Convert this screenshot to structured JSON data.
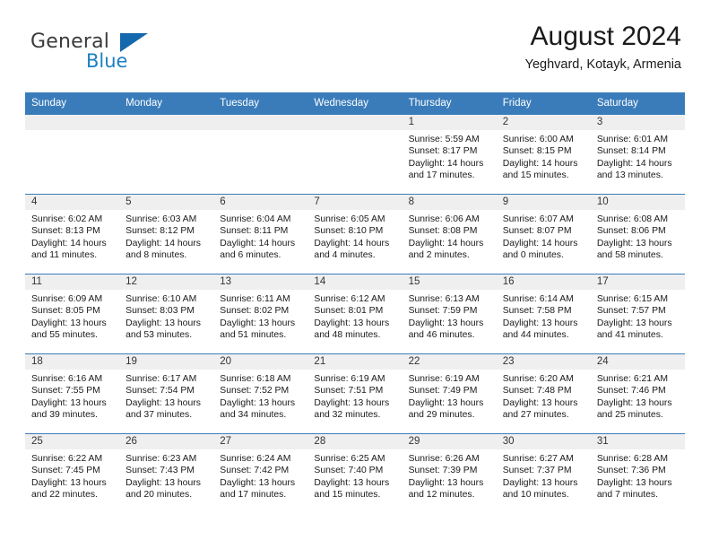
{
  "brand": {
    "word_one": "General",
    "word_two": "Blue",
    "triangle_icon": "triangle-icon",
    "colors": {
      "blue": "#1c7fc4",
      "dark": "#3b3b3b",
      "triangle": "#1668ad"
    }
  },
  "header": {
    "title": "August 2024",
    "subtitle": "Yeghvard, Kotayk, Armenia"
  },
  "calendar": {
    "accent_color": "#3a7cba",
    "weekday_headers": [
      "Sunday",
      "Monday",
      "Tuesday",
      "Wednesday",
      "Thursday",
      "Friday",
      "Saturday"
    ],
    "labels": {
      "sunrise": "Sunrise:",
      "sunset": "Sunset:",
      "daylight": "Daylight:"
    },
    "weeks": [
      [
        {
          "day": ""
        },
        {
          "day": ""
        },
        {
          "day": ""
        },
        {
          "day": ""
        },
        {
          "day": "1",
          "sunrise": "Sunrise: 5:59 AM",
          "sunset": "Sunset: 8:17 PM",
          "daylight_1": "Daylight: 14 hours",
          "daylight_2": "and 17 minutes."
        },
        {
          "day": "2",
          "sunrise": "Sunrise: 6:00 AM",
          "sunset": "Sunset: 8:15 PM",
          "daylight_1": "Daylight: 14 hours",
          "daylight_2": "and 15 minutes."
        },
        {
          "day": "3",
          "sunrise": "Sunrise: 6:01 AM",
          "sunset": "Sunset: 8:14 PM",
          "daylight_1": "Daylight: 14 hours",
          "daylight_2": "and 13 minutes."
        }
      ],
      [
        {
          "day": "4",
          "sunrise": "Sunrise: 6:02 AM",
          "sunset": "Sunset: 8:13 PM",
          "daylight_1": "Daylight: 14 hours",
          "daylight_2": "and 11 minutes."
        },
        {
          "day": "5",
          "sunrise": "Sunrise: 6:03 AM",
          "sunset": "Sunset: 8:12 PM",
          "daylight_1": "Daylight: 14 hours",
          "daylight_2": "and 8 minutes."
        },
        {
          "day": "6",
          "sunrise": "Sunrise: 6:04 AM",
          "sunset": "Sunset: 8:11 PM",
          "daylight_1": "Daylight: 14 hours",
          "daylight_2": "and 6 minutes."
        },
        {
          "day": "7",
          "sunrise": "Sunrise: 6:05 AM",
          "sunset": "Sunset: 8:10 PM",
          "daylight_1": "Daylight: 14 hours",
          "daylight_2": "and 4 minutes."
        },
        {
          "day": "8",
          "sunrise": "Sunrise: 6:06 AM",
          "sunset": "Sunset: 8:08 PM",
          "daylight_1": "Daylight: 14 hours",
          "daylight_2": "and 2 minutes."
        },
        {
          "day": "9",
          "sunrise": "Sunrise: 6:07 AM",
          "sunset": "Sunset: 8:07 PM",
          "daylight_1": "Daylight: 14 hours",
          "daylight_2": "and 0 minutes."
        },
        {
          "day": "10",
          "sunrise": "Sunrise: 6:08 AM",
          "sunset": "Sunset: 8:06 PM",
          "daylight_1": "Daylight: 13 hours",
          "daylight_2": "and 58 minutes."
        }
      ],
      [
        {
          "day": "11",
          "sunrise": "Sunrise: 6:09 AM",
          "sunset": "Sunset: 8:05 PM",
          "daylight_1": "Daylight: 13 hours",
          "daylight_2": "and 55 minutes."
        },
        {
          "day": "12",
          "sunrise": "Sunrise: 6:10 AM",
          "sunset": "Sunset: 8:03 PM",
          "daylight_1": "Daylight: 13 hours",
          "daylight_2": "and 53 minutes."
        },
        {
          "day": "13",
          "sunrise": "Sunrise: 6:11 AM",
          "sunset": "Sunset: 8:02 PM",
          "daylight_1": "Daylight: 13 hours",
          "daylight_2": "and 51 minutes."
        },
        {
          "day": "14",
          "sunrise": "Sunrise: 6:12 AM",
          "sunset": "Sunset: 8:01 PM",
          "daylight_1": "Daylight: 13 hours",
          "daylight_2": "and 48 minutes."
        },
        {
          "day": "15",
          "sunrise": "Sunrise: 6:13 AM",
          "sunset": "Sunset: 7:59 PM",
          "daylight_1": "Daylight: 13 hours",
          "daylight_2": "and 46 minutes."
        },
        {
          "day": "16",
          "sunrise": "Sunrise: 6:14 AM",
          "sunset": "Sunset: 7:58 PM",
          "daylight_1": "Daylight: 13 hours",
          "daylight_2": "and 44 minutes."
        },
        {
          "day": "17",
          "sunrise": "Sunrise: 6:15 AM",
          "sunset": "Sunset: 7:57 PM",
          "daylight_1": "Daylight: 13 hours",
          "daylight_2": "and 41 minutes."
        }
      ],
      [
        {
          "day": "18",
          "sunrise": "Sunrise: 6:16 AM",
          "sunset": "Sunset: 7:55 PM",
          "daylight_1": "Daylight: 13 hours",
          "daylight_2": "and 39 minutes."
        },
        {
          "day": "19",
          "sunrise": "Sunrise: 6:17 AM",
          "sunset": "Sunset: 7:54 PM",
          "daylight_1": "Daylight: 13 hours",
          "daylight_2": "and 37 minutes."
        },
        {
          "day": "20",
          "sunrise": "Sunrise: 6:18 AM",
          "sunset": "Sunset: 7:52 PM",
          "daylight_1": "Daylight: 13 hours",
          "daylight_2": "and 34 minutes."
        },
        {
          "day": "21",
          "sunrise": "Sunrise: 6:19 AM",
          "sunset": "Sunset: 7:51 PM",
          "daylight_1": "Daylight: 13 hours",
          "daylight_2": "and 32 minutes."
        },
        {
          "day": "22",
          "sunrise": "Sunrise: 6:19 AM",
          "sunset": "Sunset: 7:49 PM",
          "daylight_1": "Daylight: 13 hours",
          "daylight_2": "and 29 minutes."
        },
        {
          "day": "23",
          "sunrise": "Sunrise: 6:20 AM",
          "sunset": "Sunset: 7:48 PM",
          "daylight_1": "Daylight: 13 hours",
          "daylight_2": "and 27 minutes."
        },
        {
          "day": "24",
          "sunrise": "Sunrise: 6:21 AM",
          "sunset": "Sunset: 7:46 PM",
          "daylight_1": "Daylight: 13 hours",
          "daylight_2": "and 25 minutes."
        }
      ],
      [
        {
          "day": "25",
          "sunrise": "Sunrise: 6:22 AM",
          "sunset": "Sunset: 7:45 PM",
          "daylight_1": "Daylight: 13 hours",
          "daylight_2": "and 22 minutes."
        },
        {
          "day": "26",
          "sunrise": "Sunrise: 6:23 AM",
          "sunset": "Sunset: 7:43 PM",
          "daylight_1": "Daylight: 13 hours",
          "daylight_2": "and 20 minutes."
        },
        {
          "day": "27",
          "sunrise": "Sunrise: 6:24 AM",
          "sunset": "Sunset: 7:42 PM",
          "daylight_1": "Daylight: 13 hours",
          "daylight_2": "and 17 minutes."
        },
        {
          "day": "28",
          "sunrise": "Sunrise: 6:25 AM",
          "sunset": "Sunset: 7:40 PM",
          "daylight_1": "Daylight: 13 hours",
          "daylight_2": "and 15 minutes."
        },
        {
          "day": "29",
          "sunrise": "Sunrise: 6:26 AM",
          "sunset": "Sunset: 7:39 PM",
          "daylight_1": "Daylight: 13 hours",
          "daylight_2": "and 12 minutes."
        },
        {
          "day": "30",
          "sunrise": "Sunrise: 6:27 AM",
          "sunset": "Sunset: 7:37 PM",
          "daylight_1": "Daylight: 13 hours",
          "daylight_2": "and 10 minutes."
        },
        {
          "day": "31",
          "sunrise": "Sunrise: 6:28 AM",
          "sunset": "Sunset: 7:36 PM",
          "daylight_1": "Daylight: 13 hours",
          "daylight_2": "and 7 minutes."
        }
      ]
    ]
  }
}
